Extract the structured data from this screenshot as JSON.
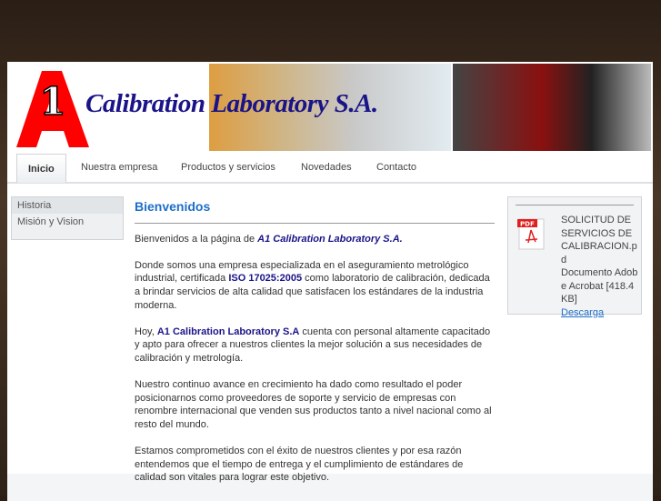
{
  "header": {
    "logo_mark": "A1",
    "brand": "Calibration Laboratory S.A."
  },
  "nav": [
    {
      "label": "Inicio"
    },
    {
      "label": "Nuestra empresa"
    },
    {
      "label": "Productos y servicios"
    },
    {
      "label": "Novedades"
    },
    {
      "label": "Contacto"
    }
  ],
  "sidebar": [
    {
      "label": "Historia"
    },
    {
      "label": "Misión y Vision"
    }
  ],
  "main": {
    "title": "Bienvenidos",
    "p1_pre": "Bienvenidos a la página de ",
    "p1_hl": "A1 Calibration Laboratory S.A.",
    "p2_pre": "Donde somos una empresa especializada en el aseguramiento metrológico industrial, certificada ",
    "p2_hl": "ISO 17025:2005",
    "p2_post": " como laboratorio de calibración, dedicada a brindar servicios de alta calidad que satisfacen los estándares de la industria moderna.",
    "p3_pre": "Hoy, ",
    "p3_hl": "A1 Calibration Laboratory S.A",
    "p3_post": " cuenta con personal altamente capacitado y apto para ofrecer a nuestros clientes la mejor solución a sus necesidades de calibración y metrología.",
    "p4": "Nuestro continuo avance en crecimiento ha dado como resultado el poder posicionarnos como proveedores de soporte y servicio de empresas con renombre internacional que venden sus productos tanto a nivel nacional como al resto del mundo.",
    "p5": "Estamos comprometidos con el éxito de nuestros clientes y por esa razón entendemos que el tiempo de entrega y el cumplimiento de estándares de calidad son vitales para lograr este objetivo."
  },
  "download": {
    "icon_label": "PDF",
    "filename": "SOLICITUD DE SERVICIOS DE CALIBRACION.pd",
    "type": "Documento Adobe Acrobat [418.4 KB]",
    "link": "Descarga"
  }
}
